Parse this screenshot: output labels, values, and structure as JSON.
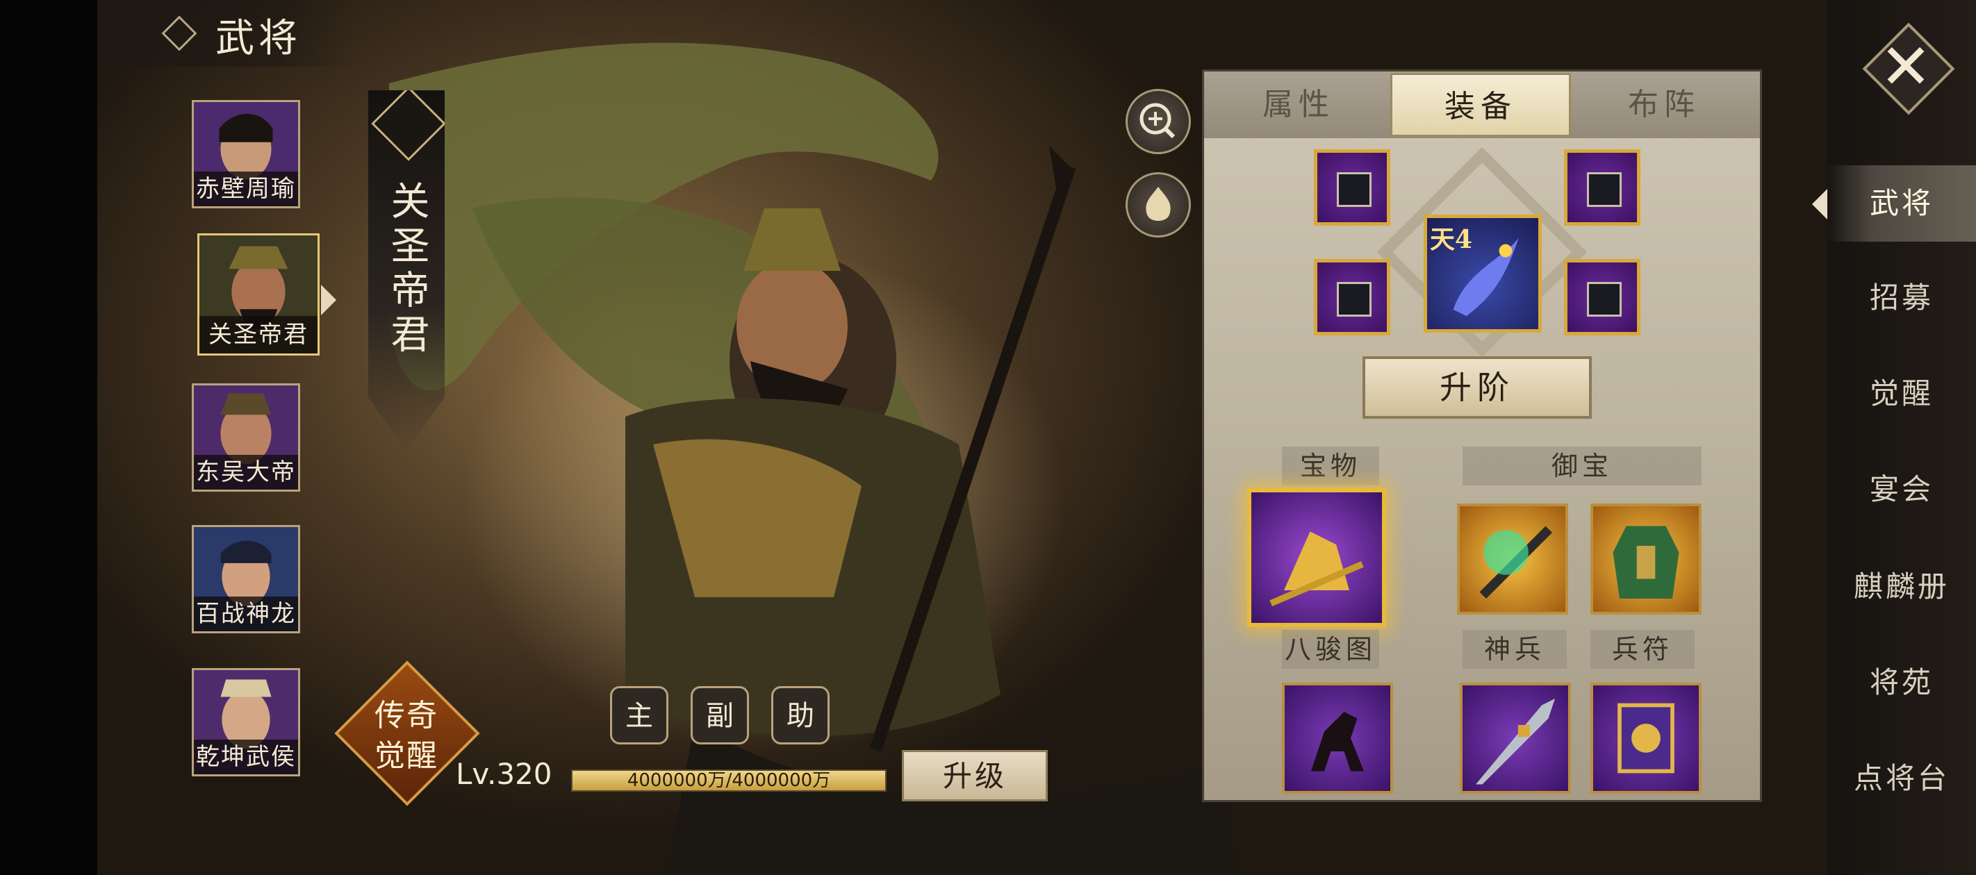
{
  "header": {
    "title": "武将"
  },
  "heroes": [
    {
      "name": "赤壁周瑜"
    },
    {
      "name": "关圣帝君",
      "selected": true
    },
    {
      "name": "东吴大帝"
    },
    {
      "name": "百战神龙"
    },
    {
      "name": "乾坤武侯"
    }
  ],
  "selected_hero": {
    "vertical_name": "关\n圣\n帝\n君"
  },
  "legend": {
    "line1": "传奇",
    "line2": "觉醒"
  },
  "roles": {
    "main": "主",
    "vice": "副",
    "assist": "助"
  },
  "level": {
    "label": "Lv.320",
    "exp_text": "4000000万/4000000万",
    "exp_fraction": 1.0
  },
  "upgrade_button": "升级",
  "panel": {
    "tabs": [
      "属性",
      "装备",
      "布阵"
    ],
    "active_tab": "装备",
    "main_item_level": "天4",
    "advance_button": "升阶",
    "section_labels": {
      "treasure": "宝物",
      "royal": "御宝",
      "bagua": "八骏图",
      "weapon": "神兵",
      "token": "兵符"
    }
  },
  "nav": [
    "武将",
    "招募",
    "觉醒",
    "宴会",
    "麒麟册",
    "将苑",
    "点将台"
  ],
  "nav_active": "武将",
  "colors": {
    "accent_gold": "#d8a93a",
    "item_purple": "#6b2a9e",
    "panel_bg": "#cfc6b3"
  }
}
